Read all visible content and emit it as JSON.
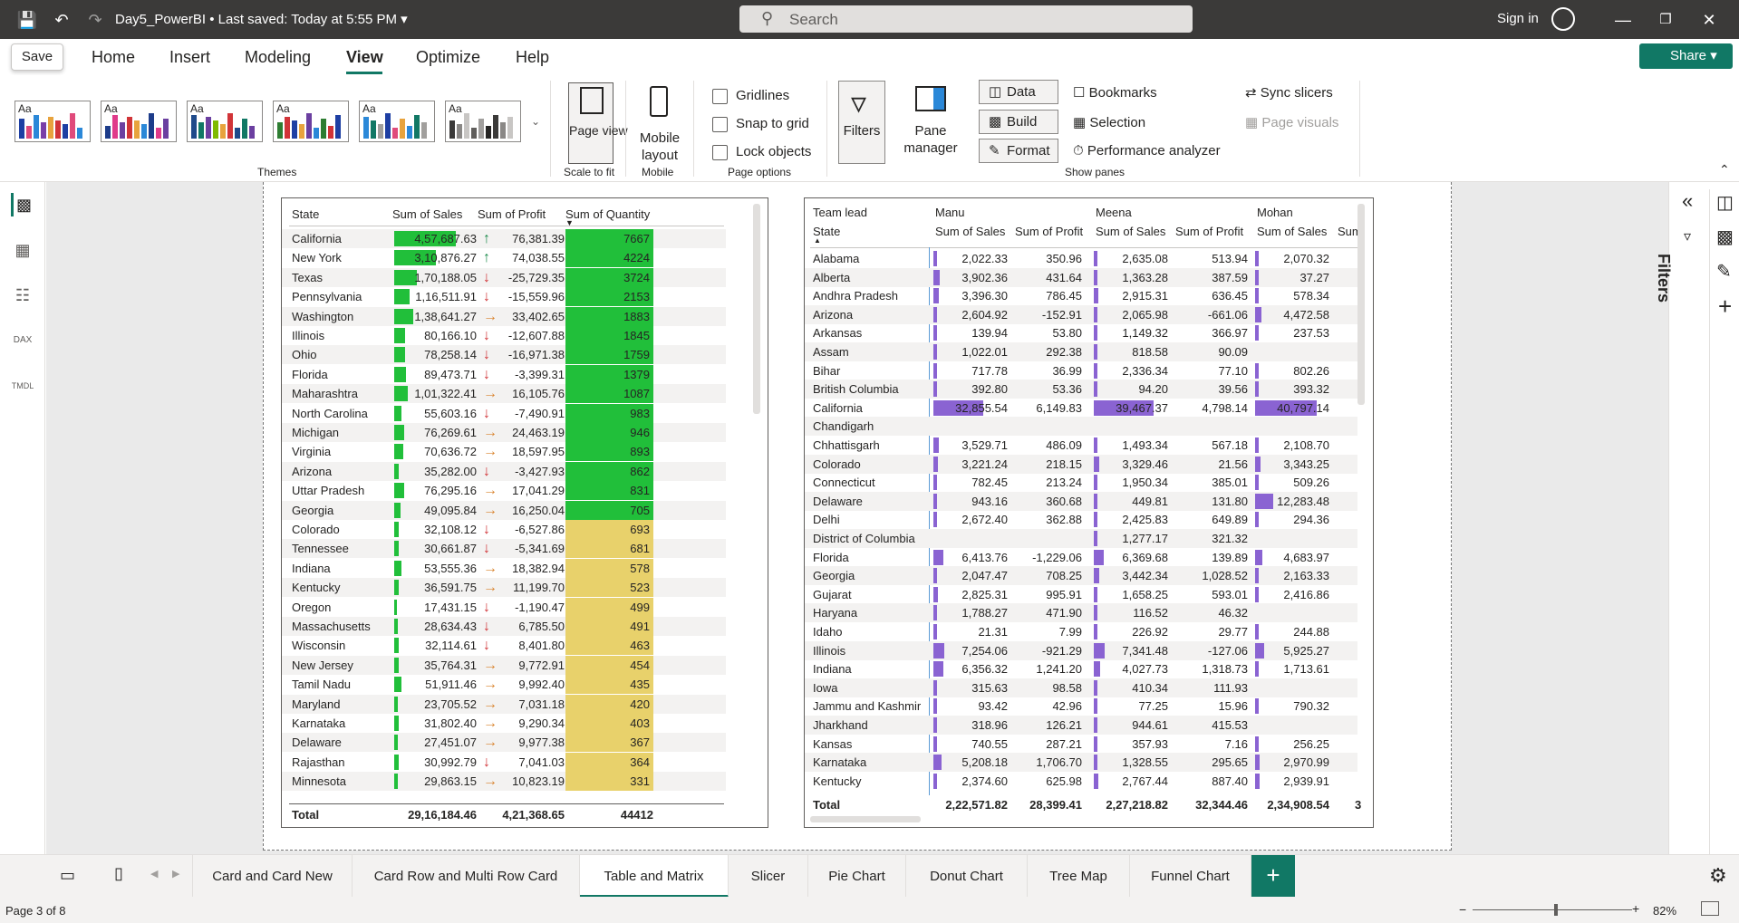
{
  "titlebar": {
    "doc_title": "Day5_PowerBI",
    "saved_status": "Last saved: Today at 5:55 PM",
    "search_placeholder": "Search",
    "signin_label": "Sign in"
  },
  "ribbon_tabs": [
    "Home",
    "Insert",
    "Modeling",
    "View",
    "Optimize",
    "Help"
  ],
  "active_tab": "View",
  "save_label": "Save",
  "share_label": "Share",
  "ribbon": {
    "themes_label": "Themes",
    "theme_aa": "Aa",
    "page_view_label": "Page view",
    "scale_to_fit": "Scale to fit",
    "mobile_layout_label": "Mobile layout",
    "mobile_group": "Mobile",
    "gridlines": "Gridlines",
    "snap_to_grid": "Snap to grid",
    "lock_objects": "Lock objects",
    "page_options": "Page options",
    "filters": "Filters",
    "pane_manager": "Pane manager",
    "data": "Data",
    "build": "Build",
    "format": "Format",
    "bookmarks": "Bookmarks",
    "selection": "Selection",
    "performance_analyzer": "Performance analyzer",
    "sync_slicers": "Sync slicers",
    "page_visuals": "Page visuals",
    "show_panes": "Show panes"
  },
  "right_pane": {
    "filters_label": "Filters"
  },
  "table_visual": {
    "headers": [
      "State",
      "Sum of Sales",
      "Sum of Profit",
      "Sum of Quantity"
    ],
    "rows": [
      {
        "state": "California",
        "sales": "4,57,687.63",
        "sales_v": 457687.63,
        "profit": "76,381.39",
        "dir": "up",
        "qty": "7667",
        "hi": true
      },
      {
        "state": "New York",
        "sales": "3,10,876.27",
        "sales_v": 310876.27,
        "profit": "74,038.55",
        "dir": "up",
        "qty": "4224",
        "hi": true
      },
      {
        "state": "Texas",
        "sales": "1,70,188.05",
        "sales_v": 170188.05,
        "profit": "-25,729.35",
        "dir": "down",
        "qty": "3724",
        "hi": true
      },
      {
        "state": "Pennsylvania",
        "sales": "1,16,511.91",
        "sales_v": 116511.91,
        "profit": "-15,559.96",
        "dir": "down",
        "qty": "2153",
        "hi": true
      },
      {
        "state": "Washington",
        "sales": "1,38,641.27",
        "sales_v": 138641.27,
        "profit": "33,402.65",
        "dir": "right",
        "qty": "1883",
        "hi": true
      },
      {
        "state": "Illinois",
        "sales": "80,166.10",
        "sales_v": 80166.1,
        "profit": "-12,607.88",
        "dir": "down",
        "qty": "1845",
        "hi": true
      },
      {
        "state": "Ohio",
        "sales": "78,258.14",
        "sales_v": 78258.14,
        "profit": "-16,971.38",
        "dir": "down",
        "qty": "1759",
        "hi": true
      },
      {
        "state": "Florida",
        "sales": "89,473.71",
        "sales_v": 89473.71,
        "profit": "-3,399.31",
        "dir": "down",
        "qty": "1379",
        "hi": true
      },
      {
        "state": "Maharashtra",
        "sales": "1,01,322.41",
        "sales_v": 101322.41,
        "profit": "16,105.76",
        "dir": "right",
        "qty": "1087",
        "hi": true
      },
      {
        "state": "North Carolina",
        "sales": "55,603.16",
        "sales_v": 55603.16,
        "profit": "-7,490.91",
        "dir": "down",
        "qty": "983",
        "hi": true
      },
      {
        "state": "Michigan",
        "sales": "76,269.61",
        "sales_v": 76269.61,
        "profit": "24,463.19",
        "dir": "right",
        "qty": "946",
        "hi": true
      },
      {
        "state": "Virginia",
        "sales": "70,636.72",
        "sales_v": 70636.72,
        "profit": "18,597.95",
        "dir": "right",
        "qty": "893",
        "hi": true
      },
      {
        "state": "Arizona",
        "sales": "35,282.00",
        "sales_v": 35282.0,
        "profit": "-3,427.93",
        "dir": "down",
        "qty": "862",
        "hi": true
      },
      {
        "state": "Uttar Pradesh",
        "sales": "76,295.16",
        "sales_v": 76295.16,
        "profit": "17,041.29",
        "dir": "right",
        "qty": "831",
        "hi": true
      },
      {
        "state": "Georgia",
        "sales": "49,095.84",
        "sales_v": 49095.84,
        "profit": "16,250.04",
        "dir": "right",
        "qty": "705",
        "hi": true
      },
      {
        "state": "Colorado",
        "sales": "32,108.12",
        "sales_v": 32108.12,
        "profit": "-6,527.86",
        "dir": "down",
        "qty": "693",
        "hi": false
      },
      {
        "state": "Tennessee",
        "sales": "30,661.87",
        "sales_v": 30661.87,
        "profit": "-5,341.69",
        "dir": "down",
        "qty": "681",
        "hi": false
      },
      {
        "state": "Indiana",
        "sales": "53,555.36",
        "sales_v": 53555.36,
        "profit": "18,382.94",
        "dir": "right",
        "qty": "578",
        "hi": false
      },
      {
        "state": "Kentucky",
        "sales": "36,591.75",
        "sales_v": 36591.75,
        "profit": "11,199.70",
        "dir": "right",
        "qty": "523",
        "hi": false
      },
      {
        "state": "Oregon",
        "sales": "17,431.15",
        "sales_v": 17431.15,
        "profit": "-1,190.47",
        "dir": "down",
        "qty": "499",
        "hi": false
      },
      {
        "state": "Massachusetts",
        "sales": "28,634.43",
        "sales_v": 28634.43,
        "profit": "6,785.50",
        "dir": "down",
        "qty": "491",
        "hi": false
      },
      {
        "state": "Wisconsin",
        "sales": "32,114.61",
        "sales_v": 32114.61,
        "profit": "8,401.80",
        "dir": "down",
        "qty": "463",
        "hi": false
      },
      {
        "state": "New Jersey",
        "sales": "35,764.31",
        "sales_v": 35764.31,
        "profit": "9,772.91",
        "dir": "right",
        "qty": "454",
        "hi": false
      },
      {
        "state": "Tamil Nadu",
        "sales": "51,911.46",
        "sales_v": 51911.46,
        "profit": "9,992.40",
        "dir": "right",
        "qty": "435",
        "hi": false
      },
      {
        "state": "Maryland",
        "sales": "23,705.52",
        "sales_v": 23705.52,
        "profit": "7,031.18",
        "dir": "right",
        "qty": "420",
        "hi": false
      },
      {
        "state": "Karnataka",
        "sales": "31,802.40",
        "sales_v": 31802.4,
        "profit": "9,290.34",
        "dir": "right",
        "qty": "403",
        "hi": false
      },
      {
        "state": "Delaware",
        "sales": "27,451.07",
        "sales_v": 27451.07,
        "profit": "9,977.38",
        "dir": "right",
        "qty": "367",
        "hi": false
      },
      {
        "state": "Rajasthan",
        "sales": "30,992.79",
        "sales_v": 30992.79,
        "profit": "7,041.03",
        "dir": "down",
        "qty": "364",
        "hi": false
      },
      {
        "state": "Minnesota",
        "sales": "29,863.15",
        "sales_v": 29863.15,
        "profit": "10,823.19",
        "dir": "right",
        "qty": "331",
        "hi": false
      }
    ],
    "total": {
      "label": "Total",
      "sales": "29,16,184.46",
      "profit": "4,21,368.65",
      "qty": "44412"
    }
  },
  "matrix_visual": {
    "header_team_lead": "Team lead",
    "header_state": "State",
    "leads": [
      "Manu",
      "Meena",
      "Mohan"
    ],
    "measure_sales": "Sum of Sales",
    "measure_profit": "Sum of Profit",
    "extra_col": "Sum",
    "rows": [
      {
        "state": "Alabama",
        "v": [
          "2,022.33",
          "350.96",
          "2,635.08",
          "513.94",
          "2,070.32"
        ],
        "b": [
          2022.33,
          2635.08,
          2070.32
        ]
      },
      {
        "state": "Alberta",
        "v": [
          "3,902.36",
          "431.64",
          "1,363.28",
          "387.59",
          "37.27"
        ],
        "b": [
          3902.36,
          1363.28,
          37.27
        ]
      },
      {
        "state": "Andhra Pradesh",
        "v": [
          "3,396.30",
          "786.45",
          "2,915.31",
          "636.45",
          "578.34"
        ],
        "b": [
          3396.3,
          2915.31,
          578.34
        ]
      },
      {
        "state": "Arizona",
        "v": [
          "2,604.92",
          "-152.91",
          "2,065.98",
          "-661.06",
          "4,472.58"
        ],
        "b": [
          2604.92,
          2065.98,
          4472.58
        ]
      },
      {
        "state": "Arkansas",
        "v": [
          "139.94",
          "53.80",
          "1,149.32",
          "366.97",
          "237.53"
        ],
        "b": [
          139.94,
          1149.32,
          237.53
        ]
      },
      {
        "state": "Assam",
        "v": [
          "1,022.01",
          "292.38",
          "818.58",
          "90.09",
          ""
        ],
        "b": [
          1022.01,
          818.58,
          0
        ]
      },
      {
        "state": "Bihar",
        "v": [
          "717.78",
          "36.99",
          "2,336.34",
          "77.10",
          "802.26"
        ],
        "b": [
          717.78,
          2336.34,
          802.26
        ]
      },
      {
        "state": "British Columbia",
        "v": [
          "392.80",
          "53.36",
          "94.20",
          "39.56",
          "393.32"
        ],
        "b": [
          392.8,
          94.2,
          393.32
        ]
      },
      {
        "state": "California",
        "v": [
          "32,855.54",
          "6,149.83",
          "39,467.37",
          "4,798.14",
          "40,797.14"
        ],
        "b": [
          32855.54,
          39467.37,
          40797.14
        ]
      },
      {
        "state": "Chandigarh",
        "v": [
          "",
          "",
          "",
          "",
          ""
        ],
        "b": [
          0,
          0,
          0
        ]
      },
      {
        "state": "Chhattisgarh",
        "v": [
          "3,529.71",
          "486.09",
          "1,493.34",
          "567.18",
          "2,108.70"
        ],
        "b": [
          3529.71,
          1493.34,
          2108.7
        ]
      },
      {
        "state": "Colorado",
        "v": [
          "3,221.24",
          "218.15",
          "3,329.46",
          "21.56",
          "3,343.25"
        ],
        "b": [
          3221.24,
          3329.46,
          3343.25
        ]
      },
      {
        "state": "Connecticut",
        "v": [
          "782.45",
          "213.24",
          "1,950.34",
          "385.01",
          "509.26"
        ],
        "b": [
          782.45,
          1950.34,
          509.26
        ]
      },
      {
        "state": "Delaware",
        "v": [
          "943.16",
          "360.68",
          "449.81",
          "131.80",
          "12,283.48"
        ],
        "b": [
          943.16,
          449.81,
          12283.48
        ]
      },
      {
        "state": "Delhi",
        "v": [
          "2,672.40",
          "362.88",
          "2,425.83",
          "649.89",
          "294.36"
        ],
        "b": [
          2672.4,
          2425.83,
          294.36
        ]
      },
      {
        "state": "District of Columbia",
        "v": [
          "",
          "",
          "1,277.17",
          "321.32",
          ""
        ],
        "b": [
          0,
          1277.17,
          0
        ]
      },
      {
        "state": "Florida",
        "v": [
          "6,413.76",
          "-1,229.06",
          "6,369.68",
          "139.89",
          "4,683.97"
        ],
        "b": [
          6413.76,
          6369.68,
          4683.97
        ]
      },
      {
        "state": "Georgia",
        "v": [
          "2,047.47",
          "708.25",
          "3,442.34",
          "1,028.52",
          "2,163.33"
        ],
        "b": [
          2047.47,
          3442.34,
          2163.33
        ]
      },
      {
        "state": "Gujarat",
        "v": [
          "2,825.31",
          "995.91",
          "1,658.25",
          "593.01",
          "2,416.86"
        ],
        "b": [
          2825.31,
          1658.25,
          2416.86
        ]
      },
      {
        "state": "Haryana",
        "v": [
          "1,788.27",
          "471.90",
          "116.52",
          "46.32",
          ""
        ],
        "b": [
          1788.27,
          116.52,
          0
        ]
      },
      {
        "state": "Idaho",
        "v": [
          "21.31",
          "7.99",
          "226.92",
          "29.77",
          "244.88"
        ],
        "b": [
          21.31,
          226.92,
          244.88
        ]
      },
      {
        "state": "Illinois",
        "v": [
          "7,254.06",
          "-921.29",
          "7,341.48",
          "-127.06",
          "5,925.27"
        ],
        "b": [
          7254.06,
          7341.48,
          5925.27
        ]
      },
      {
        "state": "Indiana",
        "v": [
          "6,356.32",
          "1,241.20",
          "4,027.73",
          "1,318.73",
          "1,713.61"
        ],
        "b": [
          6356.32,
          4027.73,
          1713.61
        ]
      },
      {
        "state": "Iowa",
        "v": [
          "315.63",
          "98.58",
          "410.34",
          "111.93",
          ""
        ],
        "b": [
          315.63,
          410.34,
          0
        ]
      },
      {
        "state": "Jammu and Kashmir",
        "v": [
          "93.42",
          "42.96",
          "77.25",
          "15.96",
          "790.32"
        ],
        "b": [
          93.42,
          77.25,
          790.32
        ]
      },
      {
        "state": "Jharkhand",
        "v": [
          "318.96",
          "126.21",
          "944.61",
          "415.53",
          ""
        ],
        "b": [
          318.96,
          944.61,
          0
        ]
      },
      {
        "state": "Kansas",
        "v": [
          "740.55",
          "287.21",
          "357.93",
          "7.16",
          "256.25"
        ],
        "b": [
          740.55,
          357.93,
          256.25
        ]
      },
      {
        "state": "Karnataka",
        "v": [
          "5,208.18",
          "1,706.70",
          "1,328.55",
          "295.65",
          "2,970.99"
        ],
        "b": [
          5208.18,
          1328.55,
          2970.99
        ]
      },
      {
        "state": "Kentucky",
        "v": [
          "2,374.60",
          "625.98",
          "2,767.44",
          "887.40",
          "2,939.91"
        ],
        "b": [
          2374.6,
          2767.44,
          2939.91
        ]
      }
    ],
    "total": {
      "label": "Total",
      "v": [
        "2,22,571.82",
        "28,399.41",
        "2,27,218.82",
        "32,344.46",
        "2,34,908.54",
        "3"
      ]
    }
  },
  "page_tabs": [
    "Card and Card New",
    "Card Row and Multi Row Card",
    "Table and Matrix",
    "Slicer",
    "Pie Chart",
    "Donut Chart",
    "Tree Map",
    "Funnel Chart"
  ],
  "active_page": "Table and Matrix",
  "status": {
    "page_info": "Page 3 of 8",
    "zoom": "82%"
  },
  "colors": {
    "accent": "#117865",
    "green": "#21bf3a",
    "yellow": "#e8d16b",
    "purple": "#8a63d2",
    "up": "#1a8a4a",
    "down": "#d13438",
    "right": "#d9822b"
  }
}
